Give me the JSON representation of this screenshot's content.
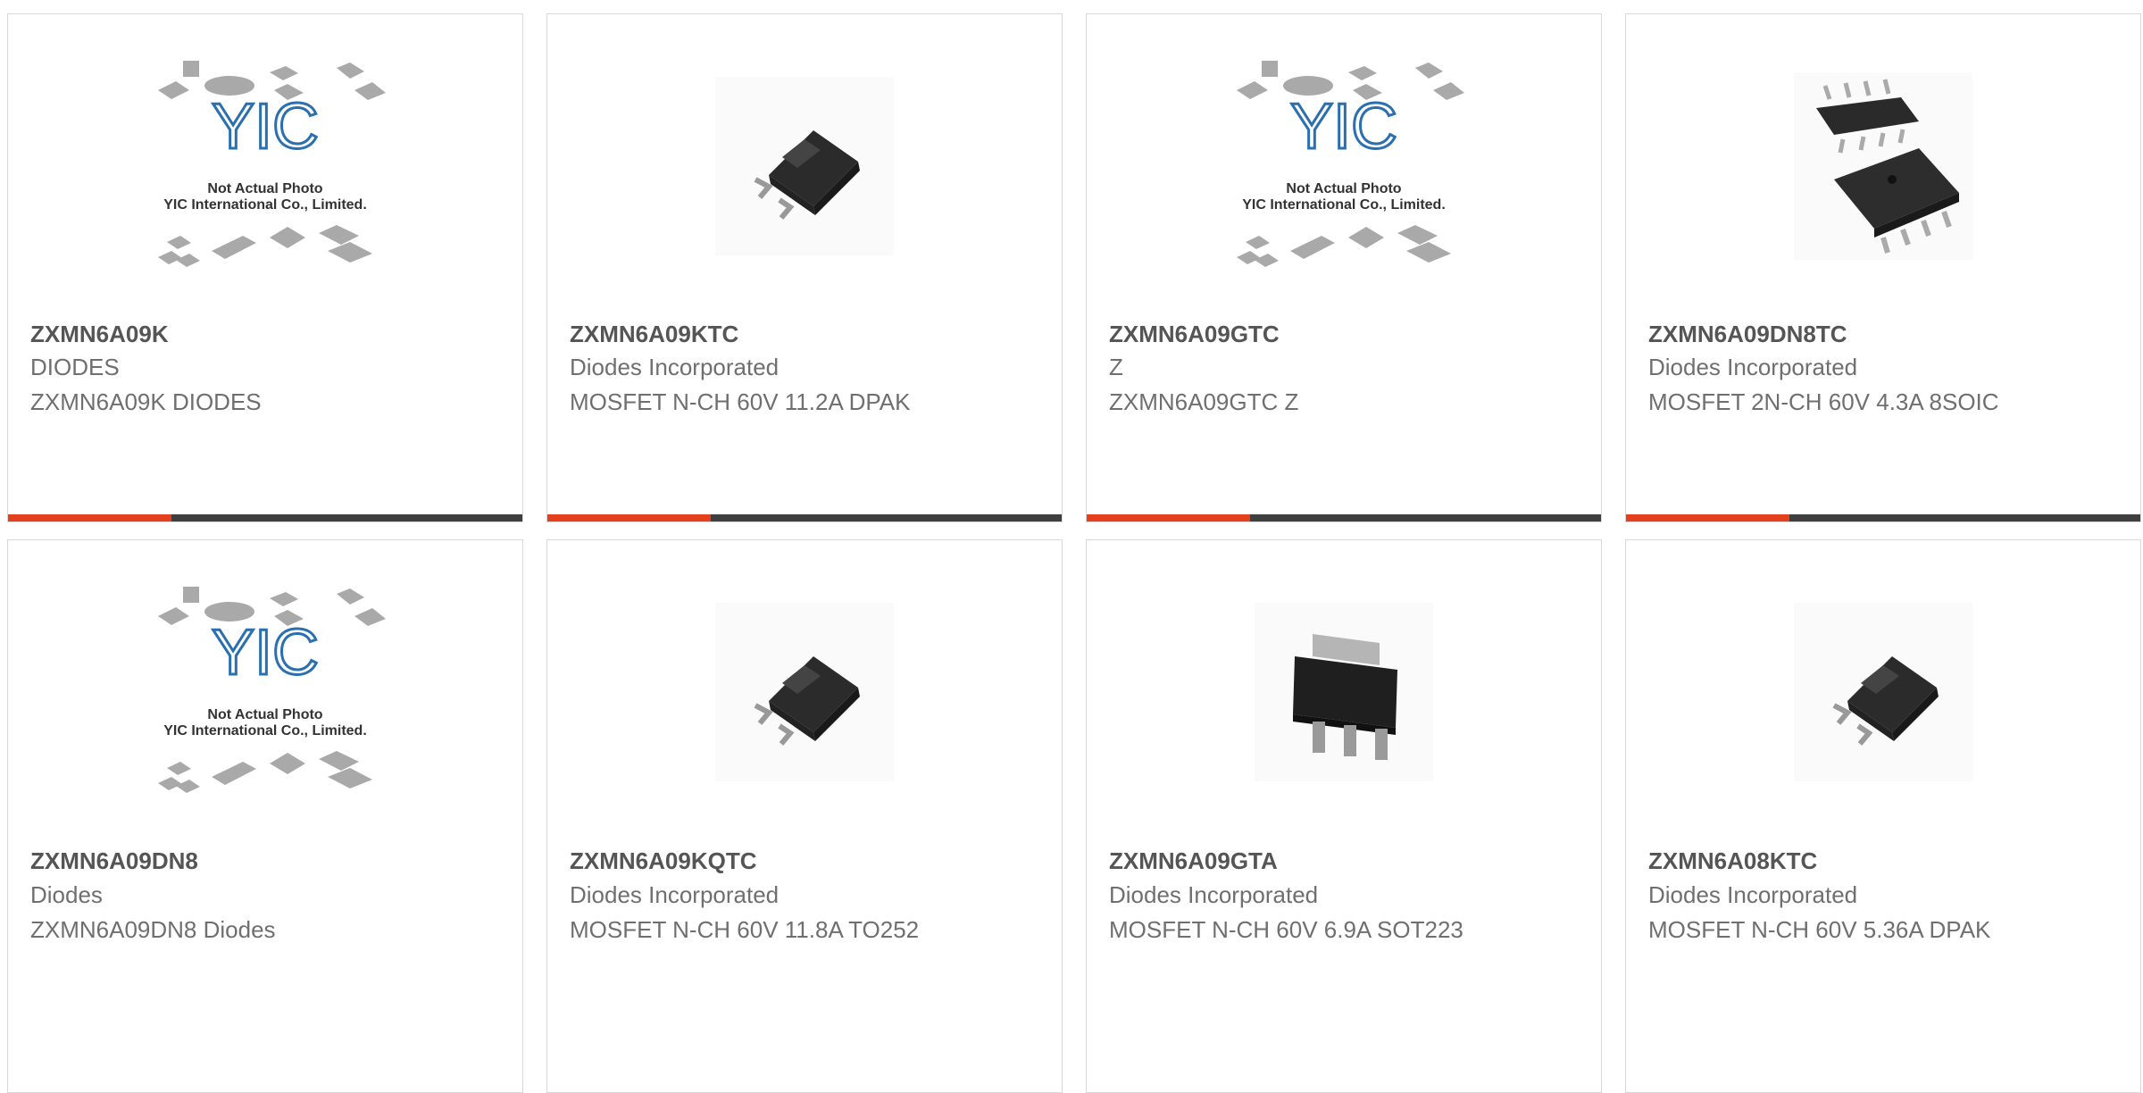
{
  "colors": {
    "accent": "#e5401e",
    "bar": "#3f3f3f",
    "border": "#d8d8d8",
    "text": "#6f6f6f",
    "logo": "#2a6fb0"
  },
  "placeholder": {
    "line1": "Not Actual Photo",
    "line2": "YIC International Co., Limited.",
    "logo": "YIC"
  },
  "products": [
    {
      "part": "ZXMN6A09K",
      "manufacturer": "DIODES",
      "description": "ZXMN6A09K DIODES",
      "image": "not-actual-photo-placeholder"
    },
    {
      "part": "ZXMN6A09KTC",
      "manufacturer": "Diodes Incorporated",
      "description": "MOSFET N-CH 60V 11.2A DPAK",
      "image": "dpak-package"
    },
    {
      "part": "ZXMN6A09GTC",
      "manufacturer": "Z",
      "description": "ZXMN6A09GTC Z",
      "image": "not-actual-photo-placeholder"
    },
    {
      "part": "ZXMN6A09DN8TC",
      "manufacturer": "Diodes Incorporated",
      "description": "MOSFET 2N-CH 60V 4.3A 8SOIC",
      "image": "soic8-package"
    },
    {
      "part": "ZXMN6A09DN8",
      "manufacturer": "Diodes",
      "description": "ZXMN6A09DN8 Diodes",
      "image": "not-actual-photo-placeholder"
    },
    {
      "part": "ZXMN6A09KQTC",
      "manufacturer": "Diodes Incorporated",
      "description": "MOSFET N-CH 60V 11.8A TO252",
      "image": "dpak-package"
    },
    {
      "part": "ZXMN6A09GTA",
      "manufacturer": "Diodes Incorporated",
      "description": "MOSFET N-CH 60V 6.9A SOT223",
      "image": "sot223-package"
    },
    {
      "part": "ZXMN6A08KTC",
      "manufacturer": "Diodes Incorporated",
      "description": "MOSFET N-CH 60V 5.36A DPAK",
      "image": "dpak-package"
    }
  ]
}
